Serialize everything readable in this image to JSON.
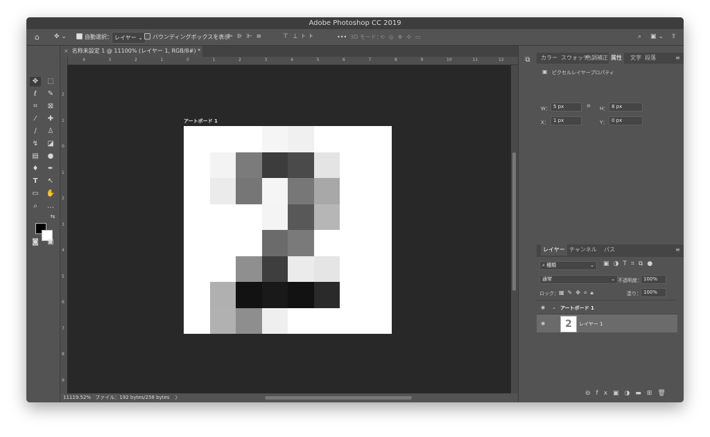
{
  "window": {
    "title": "Adobe Photoshop CC 2019"
  },
  "options": {
    "auto_select_label": "自動選択：",
    "auto_select_value": "レイヤー",
    "bounding_box_label": "バウンディングボックスを表示",
    "mode3d_label": "3D モード：",
    "more": "•••"
  },
  "document": {
    "tab_title": "名称未設定 1 @ 11100% (レイヤー 1, RGB/8#) *",
    "artboard_label": "アートボード 1",
    "ruler_h": [
      "4",
      "3",
      "2",
      "1",
      "0",
      "1",
      "2",
      "3",
      "4",
      "5",
      "6",
      "7",
      "8",
      "9",
      "10",
      "11",
      "12"
    ],
    "ruler_v": [
      "2",
      "1",
      "0",
      "1",
      "2",
      "3",
      "4",
      "5",
      "6",
      "7",
      "8",
      "9"
    ],
    "pixels": [
      [
        "#ffffff",
        "#ffffff",
        "#ffffff",
        "#f5f5f5",
        "#f0f0f0",
        "#ffffff",
        "#ffffff",
        "#ffffff"
      ],
      [
        "#ffffff",
        "#f3f3f3",
        "#7b7b7b",
        "#3c3c3c",
        "#4a4a4a",
        "#e4e4e4",
        "#ffffff",
        "#ffffff"
      ],
      [
        "#ffffff",
        "#ebebeb",
        "#767676",
        "#f5f5f5",
        "#777777",
        "#a8a8a8",
        "#ffffff",
        "#ffffff"
      ],
      [
        "#ffffff",
        "#ffffff",
        "#ffffff",
        "#f4f4f4",
        "#585858",
        "#b6b6b6",
        "#ffffff",
        "#ffffff"
      ],
      [
        "#ffffff",
        "#ffffff",
        "#ffffff",
        "#6b6b6b",
        "#7a7a7a",
        "#ffffff",
        "#ffffff",
        "#ffffff"
      ],
      [
        "#ffffff",
        "#ffffff",
        "#8f8f8f",
        "#3e3e3e",
        "#ebebeb",
        "#e5e5e5",
        "#ffffff",
        "#ffffff"
      ],
      [
        "#ffffff",
        "#b0b0b0",
        "#121212",
        "#191919",
        "#121212",
        "#2a2a2a",
        "#ffffff",
        "#ffffff"
      ],
      [
        "#ffffff",
        "#b1b1b1",
        "#8e8e8e",
        "#efefef",
        "#ffffff",
        "#ffffff",
        "#ffffff",
        "#ffffff"
      ]
    ]
  },
  "status": {
    "zoom": "11119.52%",
    "file_info": "ファイル：192 bytes/258 bytes",
    "arrow": "〉"
  },
  "panel_top": {
    "tabs": [
      "カラー",
      "スウォッチ",
      "色調補正",
      "属性",
      "文字",
      "段落"
    ],
    "active_tab": "属性",
    "properties_title": "ピクセルレイヤープロパティ",
    "w_label": "W：",
    "w": "5 px",
    "h_label": "H：",
    "h": "8 px",
    "x_label": "X：",
    "x": "1 px",
    "y_label": "Y：",
    "y": "0 px"
  },
  "layers_panel": {
    "tabs": [
      "レイヤー",
      "チャンネル",
      "パス"
    ],
    "filter_kind": "種類",
    "blend_mode": "通常",
    "opacity_label": "不透明度：",
    "opacity": "100%",
    "lock_label": "ロック：",
    "fill_label": "塗り：",
    "fill": "100%",
    "artboard_row": "アートボード 1",
    "layer_row": "レイヤー 1"
  },
  "colors": {
    "foreground": "#000000",
    "background": "#ffffff",
    "canvas": "#282828",
    "ui": "#535353"
  }
}
